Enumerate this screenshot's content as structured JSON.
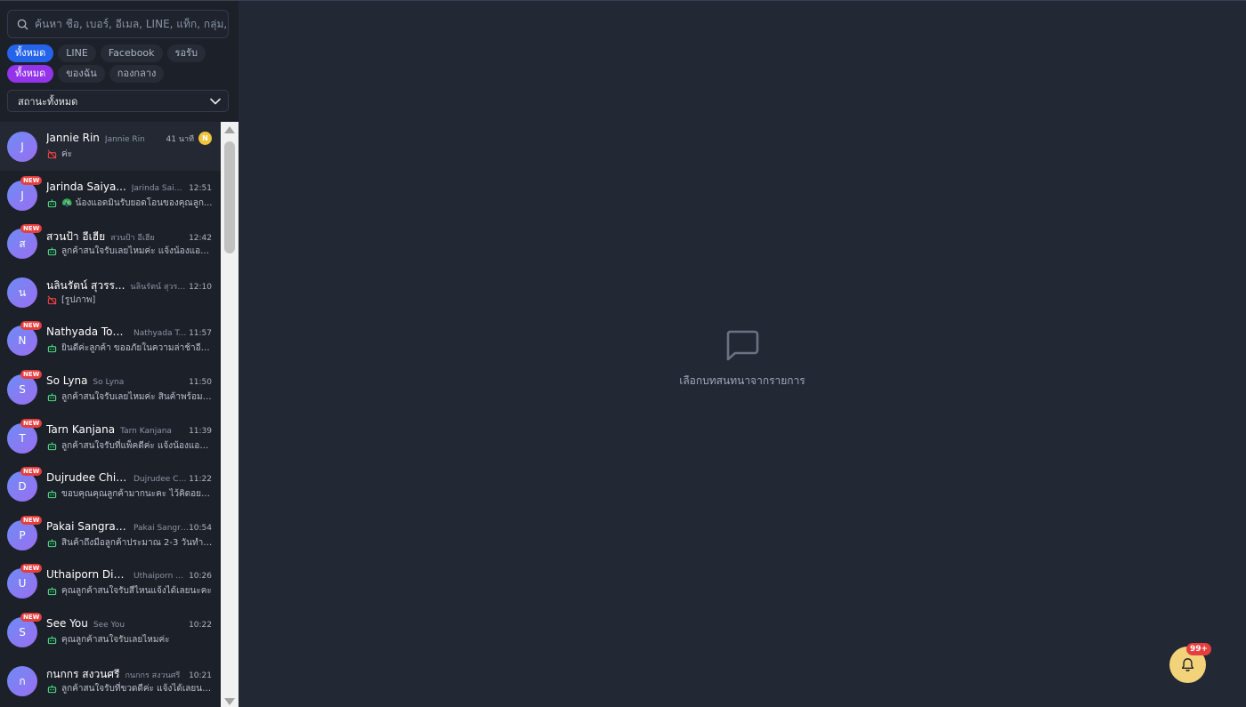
{
  "search": {
    "placeholder": "ค้นหา ชื่อ, เบอร์, อีเมล, LINE, แท็ก, กลุ่ม, ส"
  },
  "filters_channel": [
    {
      "label": "ทั้งหมด",
      "active": true
    },
    {
      "label": "LINE",
      "active": false
    },
    {
      "label": "Facebook",
      "active": false
    },
    {
      "label": "รอรับ",
      "active": false
    }
  ],
  "filters_owner": [
    {
      "label": "ทั้งหมด",
      "active": true
    },
    {
      "label": "ของฉัน",
      "active": false
    },
    {
      "label": "กองกลาง",
      "active": false
    }
  ],
  "status_select": {
    "value": "สถานะทั้งหมด"
  },
  "conversations": [
    {
      "initial": "J",
      "name": "Jannie Rin",
      "sub": "Jannie Rin",
      "time": "41 นาที",
      "assignee": "N",
      "msg": "ค่ะ",
      "new": false,
      "icon": "muted"
    },
    {
      "initial": "J",
      "name": "Jarinda Saiya...",
      "sub": "Jarinda Saiya...",
      "time": "12:51",
      "msg": "🦚 น้องแอดมินรับยอดโอนของคุณลูก...",
      "new": true,
      "icon": "bot"
    },
    {
      "initial": "ส",
      "name": "สวนป้า อีเฮีย",
      "sub": "สวนป้า อีเฮีย",
      "time": "12:42",
      "msg": "ลูกค้าสนใจรับเลยไหมค่ะ แจ้งน้องแอด...",
      "new": true,
      "icon": "bot"
    },
    {
      "initial": "น",
      "name": "นลินรัตน์ สุวรร...",
      "sub": "นลินรัตน์ สุวรร...",
      "time": "12:10",
      "msg": "[รูปภาพ]",
      "new": false,
      "icon": "muted"
    },
    {
      "initial": "N",
      "name": "Nathyada Too...",
      "sub": "Nathyada Too...",
      "time": "11:57",
      "msg": "ยินดีค่ะลูกค้า ขออภัยในความล่าช้าอีกค...",
      "new": true,
      "icon": "bot"
    },
    {
      "initial": "S",
      "name": "So Lyna",
      "sub": "So Lyna",
      "time": "11:50",
      "msg": "ลูกค้าสนใจรับเลยไหมค่ะ สินค้าพร้อมส่...",
      "new": true,
      "icon": "bot"
    },
    {
      "initial": "T",
      "name": "Tarn Kanjana",
      "sub": "Tarn Kanjana",
      "time": "11:39",
      "msg": "ลูกค้าสนใจรับที่แพ็คดีค่ะ แจ้งน้องแอด...",
      "new": true,
      "icon": "bot"
    },
    {
      "initial": "D",
      "name": "Dujrudee Chin...",
      "sub": "Dujrudee Chin...",
      "time": "11:22",
      "msg": "ขอบคุณคุณลูกค้ามากนะคะ ไว้คิดอยาก...",
      "new": true,
      "icon": "bot"
    },
    {
      "initial": "P",
      "name": "Pakai Sangrav...",
      "sub": "Pakai Sangrav...",
      "time": "10:54",
      "msg": "สินค้าถึงมือลูกค้าประมาณ 2-3 วันทำก...",
      "new": true,
      "icon": "bot"
    },
    {
      "initial": "U",
      "name": "Uthaiporn Ditv...",
      "sub": "Uthaiporn Ditv...",
      "time": "10:26",
      "msg": "คุณลูกค้าสนใจรับสีไหนแจ้งได้เลยนะคะ",
      "new": true,
      "icon": "bot"
    },
    {
      "initial": "S",
      "name": "See You",
      "sub": "See You",
      "time": "10:22",
      "msg": "คุณลูกค้าสนใจรับเลยไหมค่ะ",
      "new": true,
      "icon": "bot"
    },
    {
      "initial": "ก",
      "name": "กนกกร สงวนศรี",
      "sub": "กนกกร สงวนศรี",
      "time": "10:21",
      "msg": "ลูกค้าสนใจรับที่ขวดดีค่ะ แจ้งได้เลยนะคะ",
      "new": false,
      "icon": "bot"
    }
  ],
  "new_label": "NEW",
  "empty_state": {
    "text": "เลือกบทสนทนาจากรายการ",
    "icon": "chat-bubble-icon"
  },
  "notifications": {
    "count": "99+",
    "icon": "bell-icon"
  },
  "colors": {
    "background": "#222834",
    "sidebar": "#1c2029",
    "accent_blue": "#2563eb",
    "accent_purple": "#9333ea",
    "badge_red": "#e53e3e",
    "bell_yellow": "#f3d37a"
  }
}
